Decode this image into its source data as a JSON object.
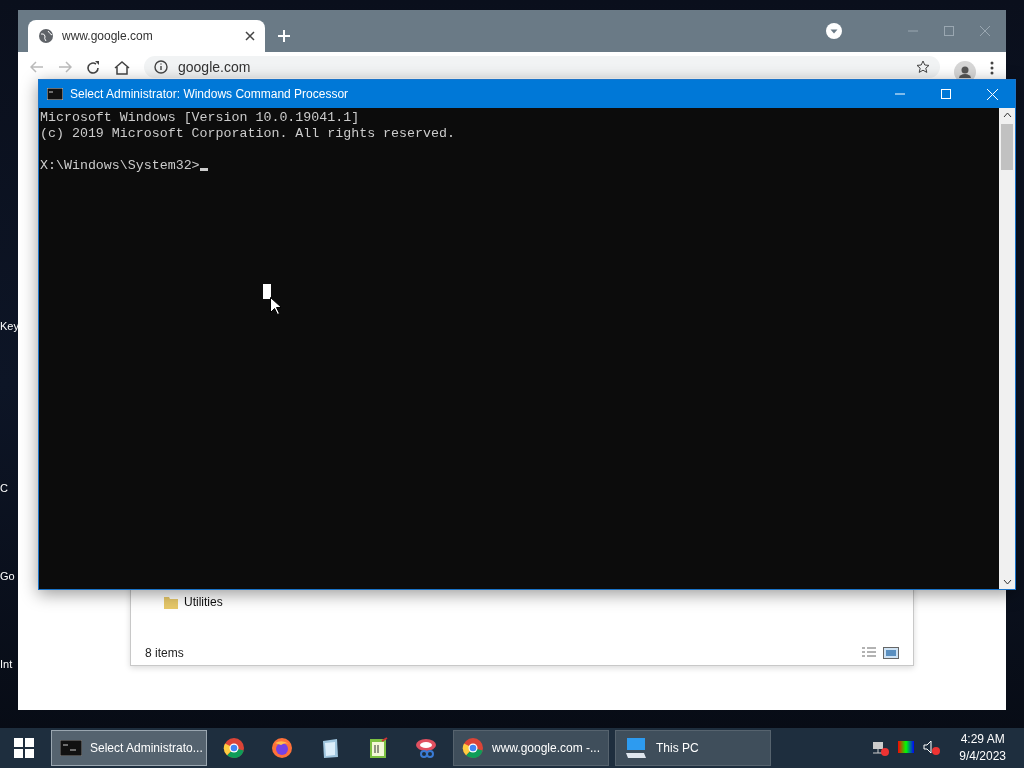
{
  "desktop": {
    "icon_labels": [
      "Key",
      "C",
      "Go",
      "Int"
    ]
  },
  "browser": {
    "tab": {
      "title": "www.google.com"
    },
    "address": "google.com"
  },
  "explorer": {
    "items": [
      "Utilities"
    ],
    "status": "8 items"
  },
  "console": {
    "title": "Select Administrator: Windows Command Processor",
    "lines": [
      "Microsoft Windows [Version 10.0.19041.1]",
      "(c) 2019 Microsoft Corporation. All rights reserved."
    ],
    "prompt": "X:\\Windows\\System32>"
  },
  "taskbar": {
    "tasks": [
      {
        "kind": "window",
        "label": "Select Administrato...",
        "selected": true
      },
      {
        "kind": "pinned"
      },
      {
        "kind": "pinned"
      },
      {
        "kind": "pinned"
      },
      {
        "kind": "pinned"
      },
      {
        "kind": "pinned"
      },
      {
        "kind": "window",
        "label": "www.google.com -...",
        "selected": false
      },
      {
        "kind": "window",
        "label": "This PC",
        "selected": false
      }
    ],
    "time": "4:29 AM",
    "date": "9/4/2023"
  }
}
